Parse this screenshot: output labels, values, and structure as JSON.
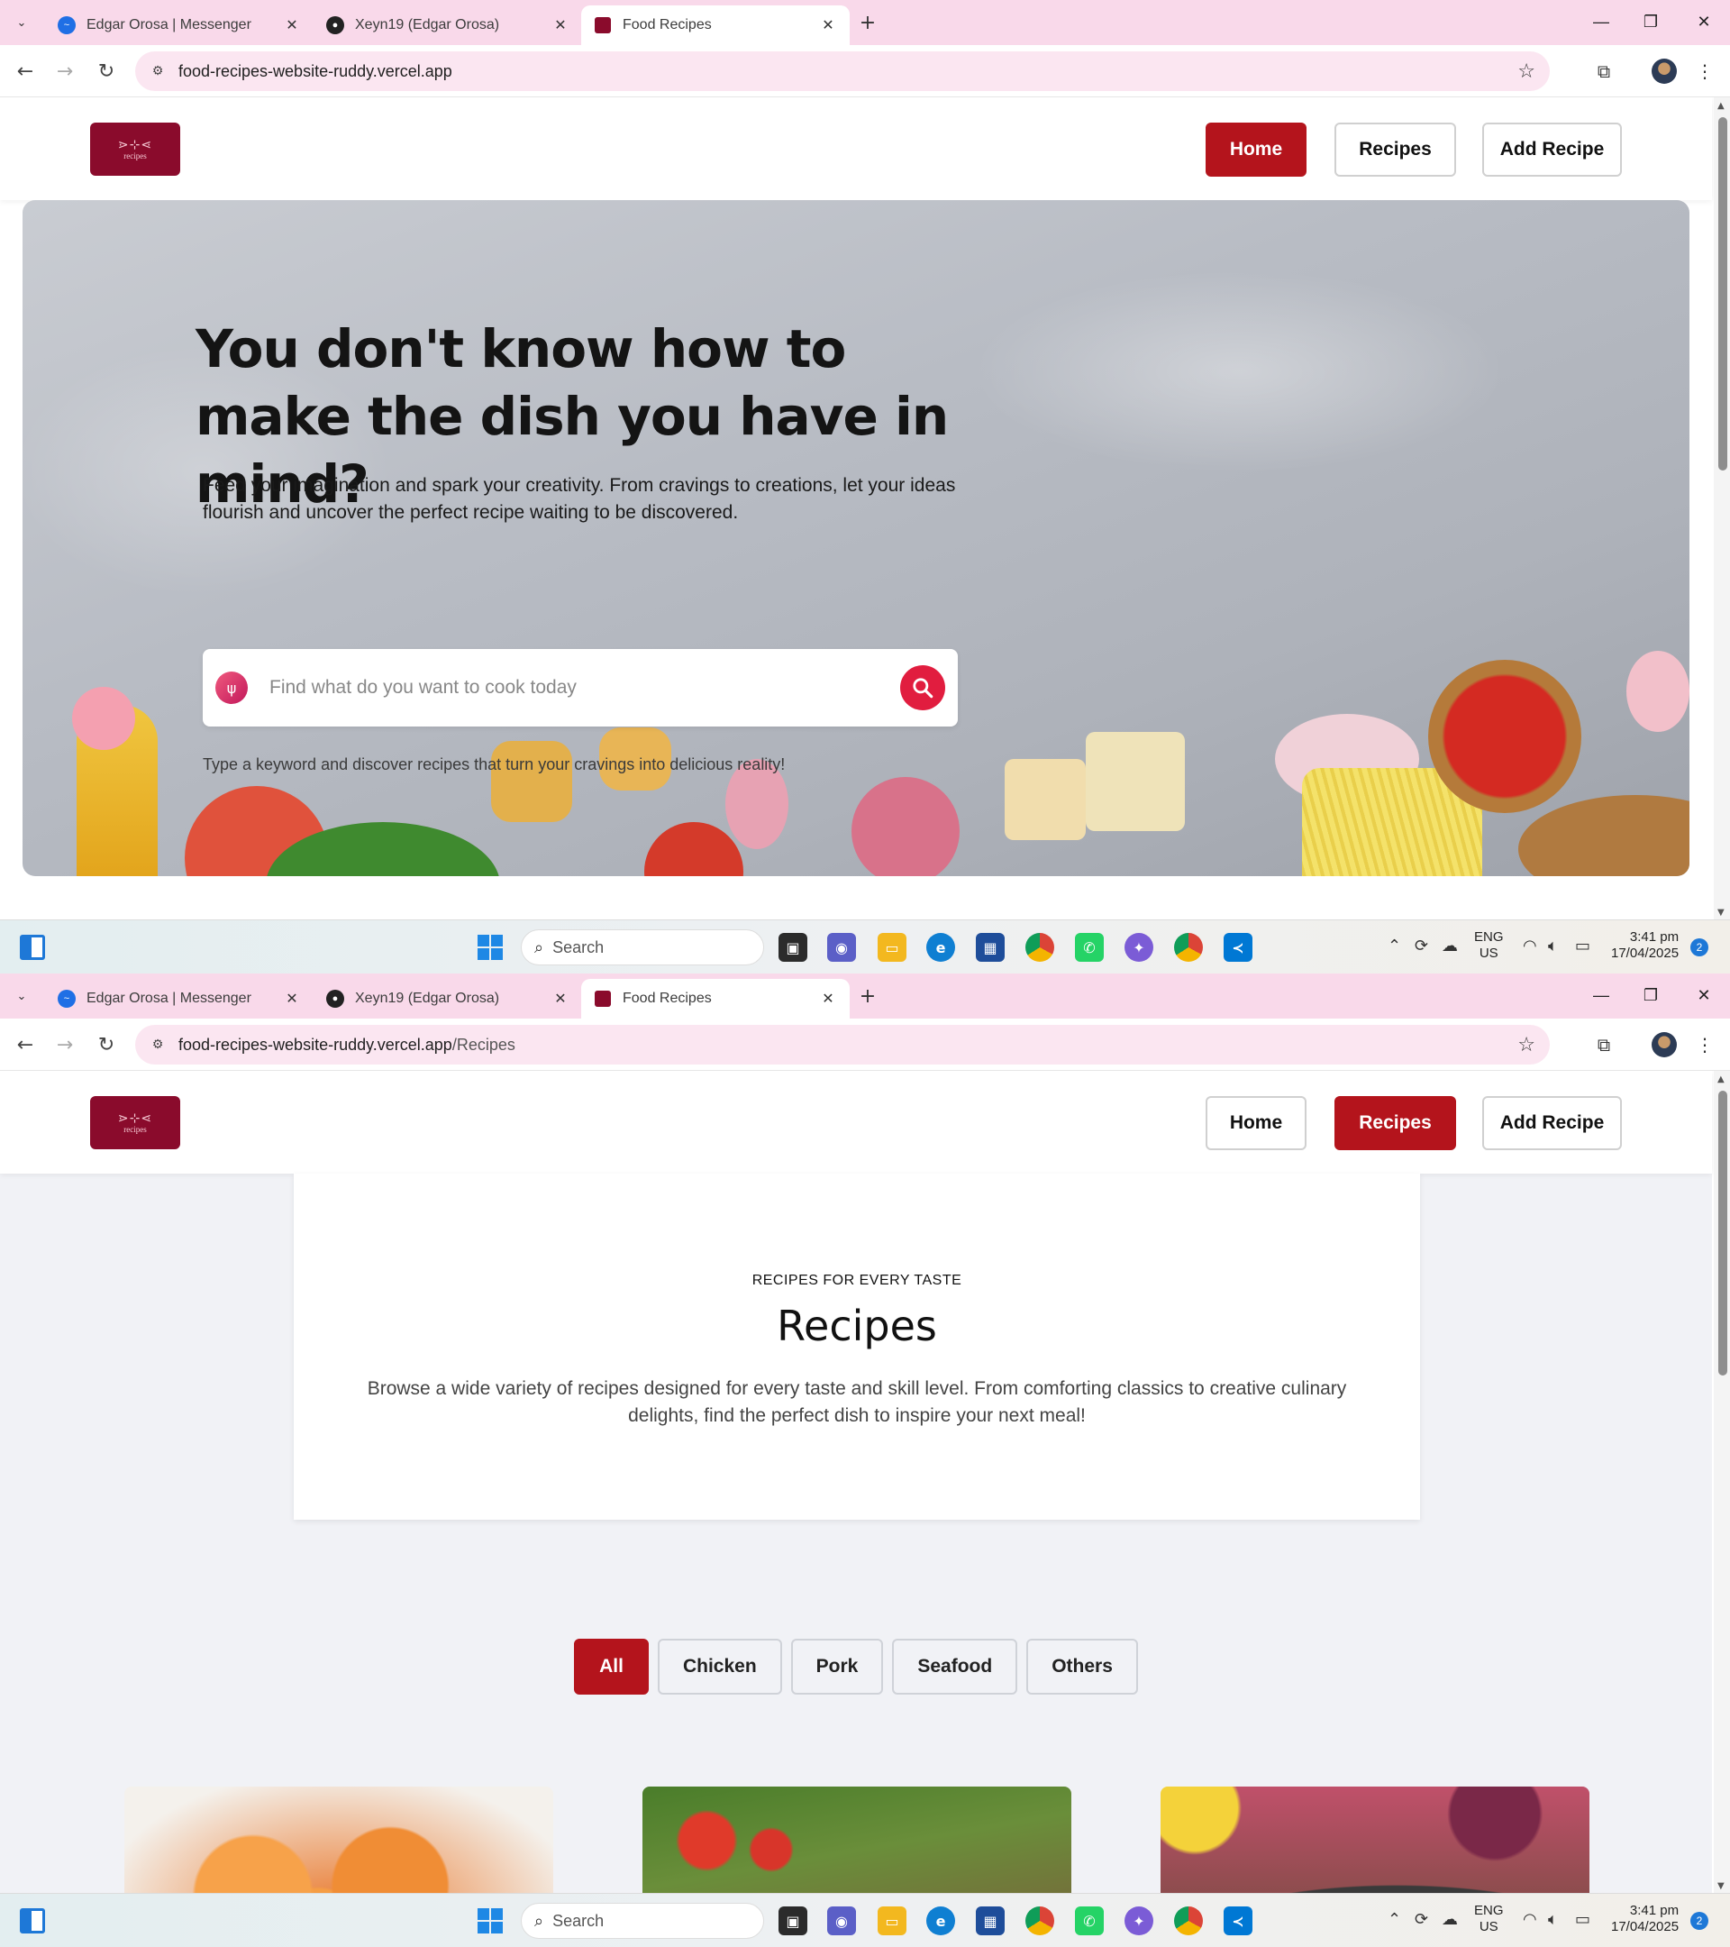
{
  "browser": {
    "tabs": [
      {
        "title": "Edgar Orosa | Messenger",
        "icon": "messenger-icon"
      },
      {
        "title": "Xeyn19 (Edgar Orosa)",
        "icon": "github-icon"
      },
      {
        "title": "Food Recipes",
        "icon": "food-recipes-favicon"
      }
    ],
    "window1_url": {
      "host": "food-recipes-website-ruddy.vercel.app",
      "path": ""
    },
    "window2_url": {
      "host": "food-recipes-website-ruddy.vercel.app",
      "path": "/Recipes"
    }
  },
  "site": {
    "logo_text": "recipes",
    "nav": {
      "home": "Home",
      "recipes": "Recipes",
      "add": "Add Recipe"
    },
    "brand_color": "#b4141c",
    "logo_color": "#8a0b2c"
  },
  "home": {
    "headline": "You don't know how to make the dish you have in mind?",
    "lead": "Feed your imagination and spark your creativity. From cravings to creations, let your ideas flourish and uncover the perfect recipe waiting to be discovered.",
    "search_placeholder": "Find what do you want to cook today",
    "hint": "Type a keyword and discover recipes that turn your cravings into delicious reality!"
  },
  "recipes_page": {
    "eyebrow": "RECIPES FOR EVERY TASTE",
    "title": "Recipes",
    "description": "Browse a wide variety of recipes designed for every taste and skill level. From comforting classics to creative culinary delights, find the perfect dish to inspire your next meal!",
    "filters": [
      "All",
      "Chicken",
      "Pork",
      "Seafood",
      "Others"
    ],
    "active_filter": "All"
  },
  "taskbar": {
    "search": "Search",
    "lang_top": "ENG",
    "lang_bottom": "US",
    "time": "3:41 pm",
    "date": "17/04/2025",
    "notifications": "2"
  }
}
